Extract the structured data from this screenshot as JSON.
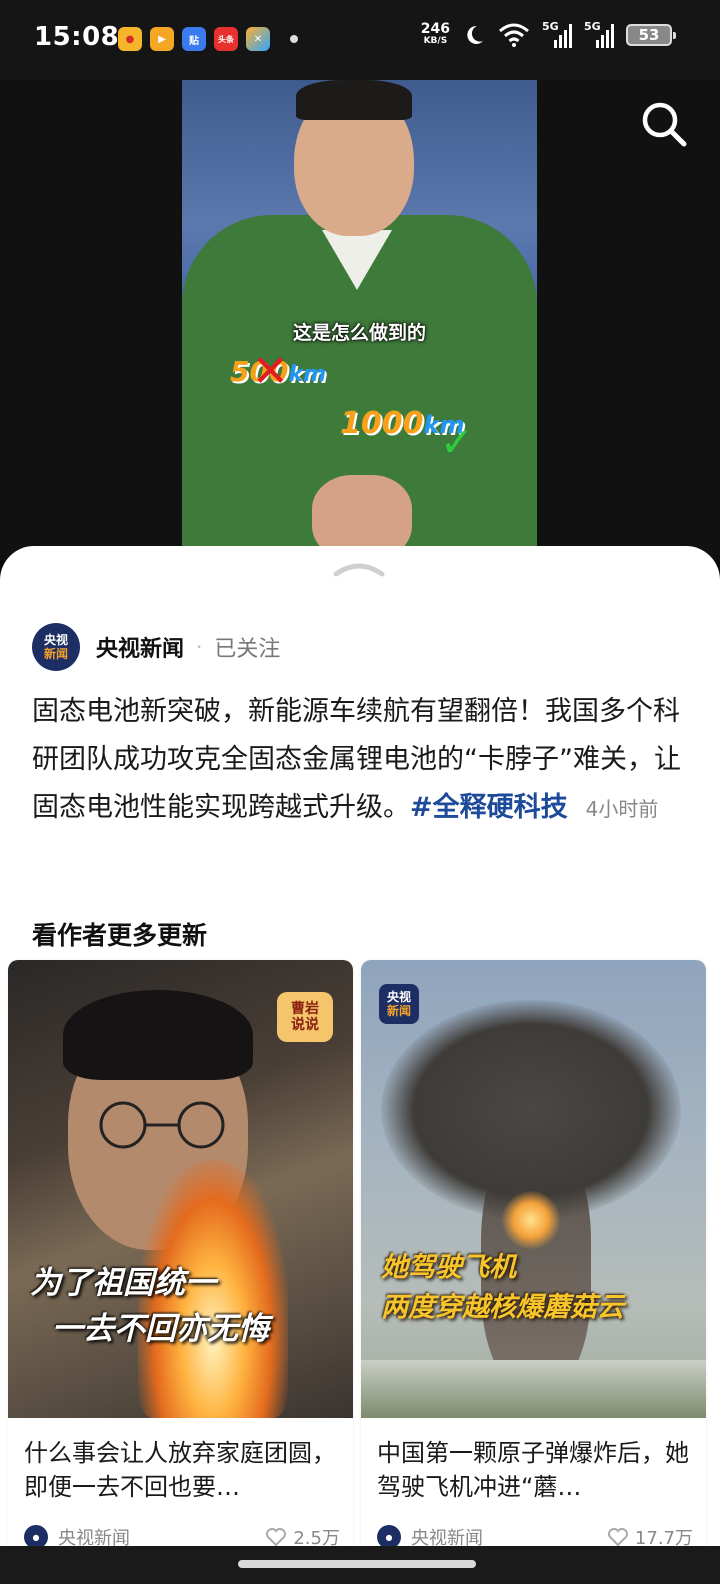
{
  "status_bar": {
    "time": "15:08",
    "net_speed": "246",
    "net_unit": "KB/S",
    "signal1_label": "5G",
    "signal2_label": "5G",
    "battery": "53",
    "app_icons": [
      "weibo-icon",
      "video-app-icon",
      "tieba-icon",
      "toutiao-icon",
      "sports-app-icon"
    ]
  },
  "video": {
    "subtitle": "这是怎么做到的",
    "old_range_value": "500",
    "old_range_unit": "km",
    "new_range_value": "1000",
    "new_range_unit": "km"
  },
  "post": {
    "author_avatar_line1": "央视",
    "author_avatar_line2": "新闻",
    "author": "央视新闻",
    "separator": "·",
    "follow_status": "已关注",
    "body": "固态电池新突破，新能源车续航有望翻倍！我国多个科研团队成功攻克全固态金属锂电池的“卡脖子”难关，让固态电池性能实现跨越式升级。",
    "hashtag": "#全释硬科技",
    "time": "4小时前"
  },
  "more": {
    "title": "看作者更多更新",
    "cards": [
      {
        "badge_line1": "曹岩",
        "badge_line2": "说说",
        "caption_line1": "为了祖国统一",
        "caption_line2": "一去不回亦无悔",
        "title": "什么事会让人放弃家庭团圆，即便一去不回也要…",
        "author": "央视新闻",
        "likes": "2.5万"
      },
      {
        "badge_line1": "央视",
        "badge_line2": "新闻",
        "caption_line1": "她驾驶飞机",
        "caption_line2": "两度穿越核爆蘑菇云",
        "title": "中国第一颗原子弹爆炸后，她驾驶飞机冲进“蘑…",
        "author": "央视新闻",
        "likes": "17.7万"
      }
    ]
  },
  "colors": {
    "accent_tag": "#1e4a9a",
    "brand_navy": "#1c2e63",
    "brand_orange": "#f3a12a"
  }
}
